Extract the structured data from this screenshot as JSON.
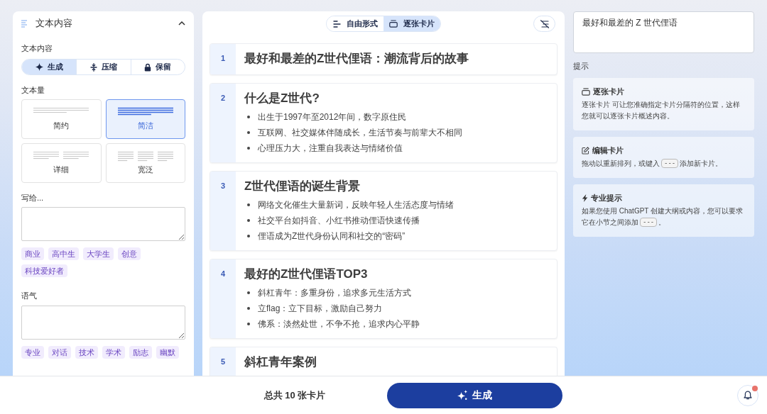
{
  "settings_panel": {
    "section": {
      "title": "文本内容",
      "expanded": true
    },
    "content_mode": {
      "label": "文本内容",
      "options": [
        {
          "label": "生成",
          "selected": true
        },
        {
          "label": "压缩",
          "selected": false
        },
        {
          "label": "保留",
          "selected": false
        }
      ]
    },
    "text_amount": {
      "label": "文本量",
      "options": [
        {
          "label": "简约",
          "selected": false
        },
        {
          "label": "简洁",
          "selected": true
        },
        {
          "label": "详细",
          "selected": false
        },
        {
          "label": "宽泛",
          "selected": false
        }
      ]
    },
    "audience": {
      "label": "写给...",
      "chips": [
        "商业",
        "高中生",
        "大学生",
        "创意",
        "科技爱好者"
      ]
    },
    "tone": {
      "label": "语气",
      "chips": [
        "专业",
        "对话",
        "技术",
        "学术",
        "励志",
        "幽默"
      ]
    }
  },
  "content_panel": {
    "view_modes": [
      {
        "label": "自由形式",
        "selected": false
      },
      {
        "label": "逐张卡片",
        "selected": true
      }
    ],
    "cards": [
      {
        "number": "1",
        "title": "最好和最差的Z世代俚语：潮流背后的故事"
      },
      {
        "number": "2",
        "title": "什么是Z世代?",
        "bullets": [
          "出生于1997年至2012年间，数字原住民",
          "互联网、社交媒体伴随成长，生活节奏与前辈大不相同",
          "心理压力大，注重自我表达与情绪价值"
        ]
      },
      {
        "number": "3",
        "title": "Z世代俚语的诞生背景",
        "bullets": [
          "网络文化催生大量新词，反映年轻人生活态度与情绪",
          "社交平台如抖音、小红书推动俚语快速传播",
          "俚语成为Z世代身份认同和社交的“密码”"
        ]
      },
      {
        "number": "4",
        "title": "最好的Z世代俚语TOP3",
        "bullets": [
          "斜杠青年：多重身份，追求多元生活方式",
          "立flag：立下目标，激励自己努力",
          "佛系：淡然处世，不争不抢，追求内心平静"
        ]
      },
      {
        "number": "5",
        "title": "斜杠青年案例"
      }
    ]
  },
  "notes_panel": {
    "value": "最好和最差的 Z 世代俚语"
  },
  "tips": {
    "label": "提示",
    "items": [
      {
        "title": "逐张卡片",
        "parts": [
          {
            "kind": "text",
            "text": "逐张卡片 可让您准确指定卡片分隔符的位置，这样您就可以逐张卡片概述内容。"
          }
        ]
      },
      {
        "title": "编辑卡片",
        "parts": [
          {
            "kind": "text",
            "text": "拖动以重新排列，或键入"
          },
          {
            "kind": "key",
            "text": "---"
          },
          {
            "kind": "text",
            "text": "添加新卡片。"
          }
        ]
      },
      {
        "title": "专业提示",
        "parts": [
          {
            "kind": "text",
            "text": "如果您使用 ChatGPT 创建大纲或内容，您可以要求它在小节之间添加"
          },
          {
            "kind": "key",
            "text": "---"
          },
          {
            "kind": "text",
            "text": "。"
          }
        ]
      }
    ]
  },
  "footer": {
    "card_count": "总共 10 张卡片",
    "generate_button": "生成",
    "notification_dot": true
  }
}
